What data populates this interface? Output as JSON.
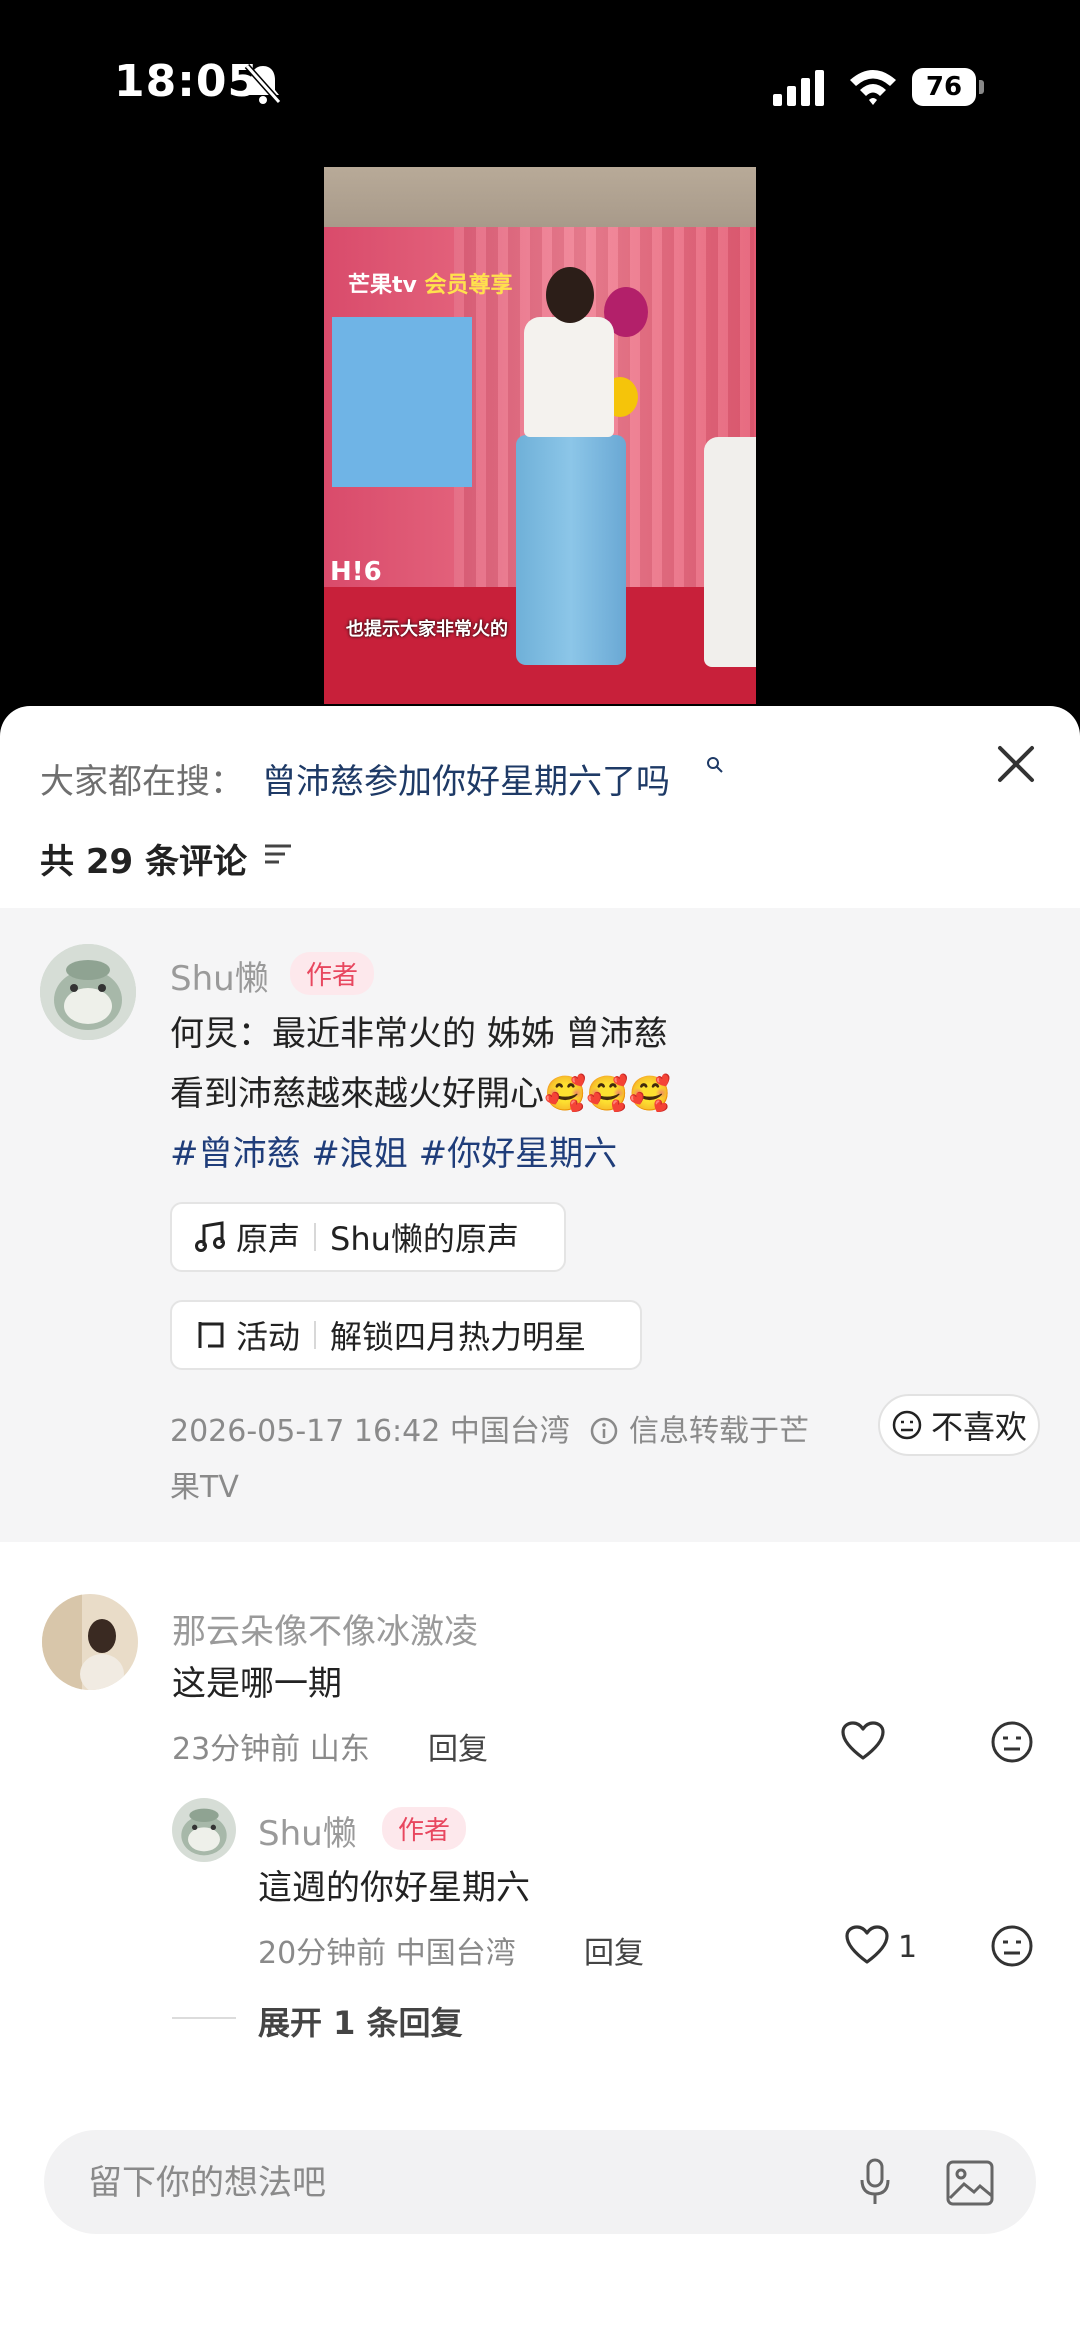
{
  "status_bar": {
    "time": "18:05",
    "battery": "76"
  },
  "video": {
    "logo_text": "芒果tv",
    "logo_badge": "会员尊享",
    "subtitle": "也提示大家非常火的",
    "stage_text": "H!6"
  },
  "sheet": {
    "search_prefix": "大家都在搜：",
    "search_query": "曾沛慈参加你好星期六了吗",
    "comment_count": "共 29 条评论"
  },
  "author_post": {
    "username": "Shu懒",
    "badge": "作者",
    "line1": "何炅：最近非常火的 姊姊 曾沛慈",
    "line2": "看到沛慈越來越火好開心",
    "emoji": "🥰🥰🥰",
    "hashtags": [
      "#曾沛慈",
      "#浪姐",
      "#你好星期六"
    ],
    "sound_chip": {
      "label": "原声",
      "value": "Shu懒的原声"
    },
    "activity_chip": {
      "label": "活动",
      "value": "解锁四月热力明星"
    },
    "meta_line1": "2026-05-17 16:42  中国台湾",
    "source_note": "信息转载于芒",
    "meta_line2": "果TV",
    "dislike_label": "不喜欢"
  },
  "comments": [
    {
      "username": "那云朵像不像冰激凌",
      "text": "这是哪一期",
      "meta": "23分钟前 山东",
      "reply_label": "回复",
      "likes": ""
    }
  ],
  "reply": {
    "username": "Shu懒",
    "badge": "作者",
    "text": "這週的你好星期六",
    "meta": "20分钟前 中国台湾",
    "reply_label": "回复",
    "likes": "1"
  },
  "expand_label": "展开 1 条回复",
  "input": {
    "placeholder": "留下你的想法吧"
  },
  "colors": {
    "accent_red": "#e8475f",
    "hashtag_blue": "#1f3d7a"
  },
  "icons": [
    "bell-slash-icon",
    "signal-icon",
    "wifi-icon",
    "battery-icon",
    "search-icon",
    "close-icon",
    "sort-icon",
    "music-note-icon",
    "activity-icon",
    "info-icon",
    "neutral-face-icon",
    "heart-icon",
    "microphone-icon",
    "image-icon"
  ]
}
